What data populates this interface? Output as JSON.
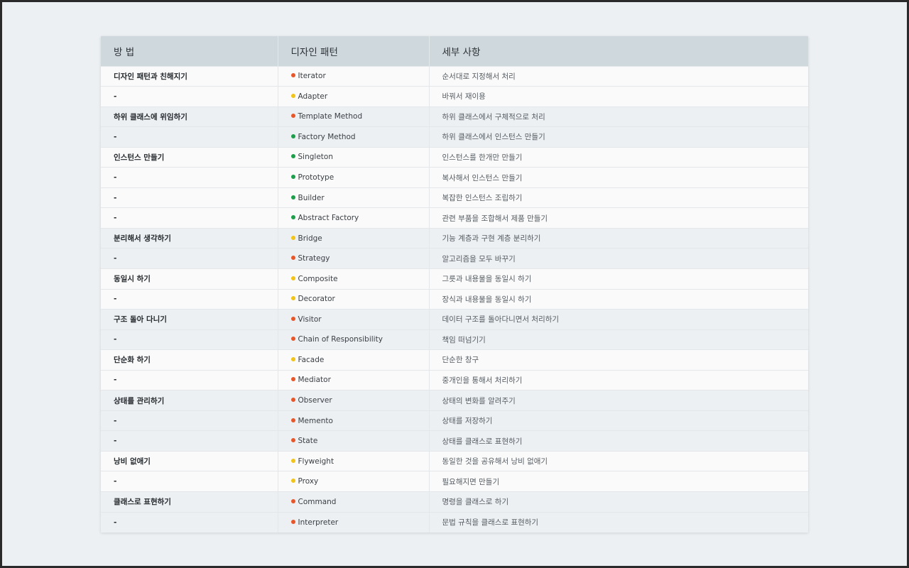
{
  "colors": {
    "red": "#e8572a",
    "yellow": "#f2c318",
    "green": "#1e9e4a"
  },
  "table": {
    "headers": [
      "방 법",
      "디자인 패턴",
      "세부 사항"
    ],
    "rows": [
      {
        "method": "디자인 패턴과 친해지기",
        "pattern": "Iterator",
        "dot": "red",
        "detail": "순서대로 지정해서 처리"
      },
      {
        "method": "-",
        "pattern": "Adapter",
        "dot": "yellow",
        "detail": "바꿔서 재이용"
      },
      {
        "method": "하위 클래스에 위임하기",
        "pattern": "Template Method",
        "dot": "red",
        "detail": "하위 클래스에서 구체적으로 처리"
      },
      {
        "method": "-",
        "pattern": "Factory Method",
        "dot": "green",
        "detail": "하위 클래스에서 인스턴스 만들기"
      },
      {
        "method": "인스턴스 만들기",
        "pattern": "Singleton",
        "dot": "green",
        "detail": "인스턴스를 한개만 만들기"
      },
      {
        "method": "-",
        "pattern": "Prototype",
        "dot": "green",
        "detail": "복사해서 인스턴스 만들기"
      },
      {
        "method": "-",
        "pattern": "Builder",
        "dot": "green",
        "detail": "복잡한 인스턴스 조립하기"
      },
      {
        "method": "-",
        "pattern": "Abstract Factory",
        "dot": "green",
        "detail": "관련 부품을 조합해서 제품 만들기"
      },
      {
        "method": "분리해서 생각하기",
        "pattern": "Bridge",
        "dot": "yellow",
        "detail": "기능 계층과 구현 계층 분리하기"
      },
      {
        "method": "-",
        "pattern": "Strategy",
        "dot": "red",
        "detail": "알고리즘을 모두 바꾸기"
      },
      {
        "method": "동일시 하기",
        "pattern": "Composite",
        "dot": "yellow",
        "detail": "그릇과 내용물을 동일시 하기"
      },
      {
        "method": "-",
        "pattern": "Decorator",
        "dot": "yellow",
        "detail": "장식과 내용물을 동일시 하기"
      },
      {
        "method": "구조 돌아 다니기",
        "pattern": "Visitor",
        "dot": "red",
        "detail": "데이터 구조를 돌아다니면서 처리하기"
      },
      {
        "method": "-",
        "pattern": "Chain of Responsibility",
        "dot": "red",
        "detail": "책임 떠넘기기"
      },
      {
        "method": "단순화 하기",
        "pattern": "Facade",
        "dot": "yellow",
        "detail": "단순한 창구"
      },
      {
        "method": "-",
        "pattern": "Mediator",
        "dot": "red",
        "detail": "중개인을 통해서 처리하기"
      },
      {
        "method": "상태를 관리하기",
        "pattern": "Observer",
        "dot": "red",
        "detail": "상태의 변화를 알려주기"
      },
      {
        "method": "-",
        "pattern": "Memento",
        "dot": "red",
        "detail": "상태를 저장하기"
      },
      {
        "method": "-",
        "pattern": "State",
        "dot": "red",
        "detail": "상태를 클래스로 표현하기"
      },
      {
        "method": "낭비 없애기",
        "pattern": "Flyweight",
        "dot": "yellow",
        "detail": "동일한 것을 공유해서 낭비 없애기"
      },
      {
        "method": "-",
        "pattern": "Proxy",
        "dot": "yellow",
        "detail": "필요해지면 만들기"
      },
      {
        "method": "클래스로 표현하기",
        "pattern": "Command",
        "dot": "red",
        "detail": "명령을 클래스로 하기"
      },
      {
        "method": "-",
        "pattern": "Interpreter",
        "dot": "red",
        "detail": "문법 규칙을 클래스로 표현하기"
      }
    ]
  }
}
